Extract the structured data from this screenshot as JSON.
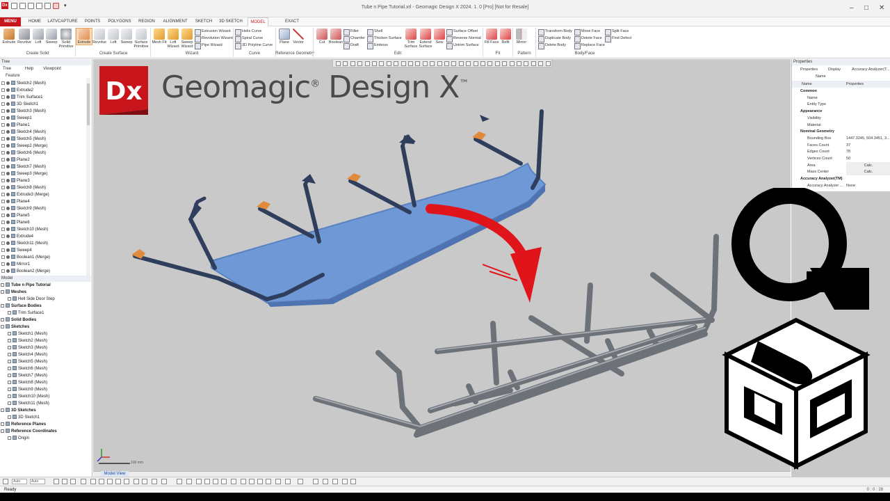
{
  "window": {
    "app_icon": "Dx",
    "title": "Tube n Pipe Tutorial.xrl - Geomagic Design X 2024. 1. 0 [Pro] [Not for Resale]"
  },
  "tabs": [
    "MENU",
    "HOME",
    "LATVCAPTURE",
    "POINTS",
    "POLYGONS",
    "REGION",
    "ALIGNMENT",
    "SKETCH",
    "3D SKETCH",
    "MODEL",
    "EXACT SURFACING"
  ],
  "active_tab": "MODEL",
  "ribbon": {
    "create_solid": {
      "label": "Create Solid",
      "buttons": [
        "Extrude",
        "Revolve",
        "Loft",
        "Sweep",
        "Solid Primitive"
      ]
    },
    "create_surface": {
      "label": "Create Surface",
      "buttons": [
        "Extrude",
        "Revolve",
        "Loft",
        "Sweep",
        "Surface Primitive"
      ]
    },
    "wizard": {
      "label": "Wizard",
      "buttons": [
        "Mesh Fit",
        "Loft Wizard",
        "Sweep Wizard"
      ],
      "small": [
        "Extrusion Wizard",
        "Revolution Wizard",
        "Pipe Wizard"
      ]
    },
    "curve": {
      "label": "Curve",
      "small": [
        "Helix Curve",
        "Spiral Curve",
        "3D Polyline Curve"
      ]
    },
    "reference_geometry": {
      "label": "Reference Geometry",
      "buttons": [
        "Plane",
        "Vector"
      ]
    },
    "edit": {
      "label": "Edit",
      "buttons": [
        "Cut",
        "Boolean"
      ],
      "small": [
        "Fillet",
        "Chamfer",
        "Draft",
        "Shell",
        "Thicken Surface",
        "Emboss"
      ]
    },
    "edit2": {
      "buttons": [
        "Trim Surface",
        "Extend Surface",
        "Sew"
      ],
      "small": [
        "Surface Offset",
        "Reverse Normal",
        "Untrim Surface"
      ]
    },
    "fit": {
      "label": "Fit",
      "buttons": [
        "Fill Face",
        "Refit"
      ]
    },
    "pattern": {
      "label": "Pattern",
      "buttons": [
        "Mirror"
      ]
    },
    "body_face": {
      "label": "Body/Face",
      "small": [
        "Transform Body",
        "Duplicate Body",
        "Delete Body",
        "Move Face",
        "Delete Face",
        "Replace Face",
        "Split Face",
        "Find Defect"
      ]
    }
  },
  "left_panel": {
    "header": "Tree",
    "tabs": [
      "Tree",
      "Help",
      "Viewpoint"
    ],
    "feature_label": "Feature",
    "features": [
      "Sketch2 (Mesh)",
      "Extrude2",
      "Trim Surface1",
      "3D Sketch1",
      "Sketch3 (Mesh)",
      "Sweep1",
      "Plane1",
      "Sketch4 (Mesh)",
      "Sketch5 (Mesh)",
      "Sweep2 (Merge)",
      "Sketch6 (Mesh)",
      "Plane2",
      "Sketch7 (Mesh)",
      "Sweep3 (Merge)",
      "Plane3",
      "Sketch8 (Mesh)",
      "Extrude3 (Merge)",
      "Plane4",
      "Sketch9 (Mesh)",
      "Plane5",
      "Plane6",
      "Sketch10 (Mesh)",
      "Extrude4",
      "Sketch11 (Mesh)",
      "Sweep4",
      "Boolean1 (Merge)",
      "Mirror1",
      "Boolean2 (Merge)"
    ],
    "model_label": "Model",
    "model_tree": [
      {
        "text": "Tube n Pipe Tutorial",
        "bold": true
      },
      {
        "text": "Meshes",
        "bold": true
      },
      {
        "text": "Hell Side Door Step",
        "bold": false
      },
      {
        "text": "Surface Bodies",
        "bold": true
      },
      {
        "text": "Trim Surface1",
        "bold": false
      },
      {
        "text": "Solid Bodies",
        "bold": true
      },
      {
        "text": "Sketches",
        "bold": true
      },
      {
        "text": "Sketch1 (Mesh)",
        "bold": false
      },
      {
        "text": "Sketch2 (Mesh)",
        "bold": false
      },
      {
        "text": "Sketch3 (Mesh)",
        "bold": false
      },
      {
        "text": "Sketch4 (Mesh)",
        "bold": false
      },
      {
        "text": "Sketch5 (Mesh)",
        "bold": false
      },
      {
        "text": "Sketch6 (Mesh)",
        "bold": false
      },
      {
        "text": "Sketch7 (Mesh)",
        "bold": false
      },
      {
        "text": "Sketch8 (Mesh)",
        "bold": false
      },
      {
        "text": "Sketch9 (Mesh)",
        "bold": false
      },
      {
        "text": "Sketch10 (Mesh)",
        "bold": false
      },
      {
        "text": "Sketch11 (Mesh)",
        "bold": false
      },
      {
        "text": "3D Sketches",
        "bold": true
      },
      {
        "text": "3D Sketch1",
        "bold": false
      },
      {
        "text": "Reference Planes",
        "bold": true
      },
      {
        "text": "Reference Coordinates",
        "bold": true
      },
      {
        "text": "Origin",
        "bold": false
      }
    ]
  },
  "viewport": {
    "brand_title": "Geomagic",
    "brand_reg": "®",
    "brand_suffix": "Design X",
    "brand_tm": "™",
    "logo_letters": "Dx",
    "scale_label": "100 mm",
    "view_tab": "Model View"
  },
  "properties": {
    "header": "Properties",
    "tabs": [
      "Properties",
      "Display",
      "Accuracy Analyzer(T..."
    ],
    "name_label": "Name",
    "col_name": "Name",
    "col_props": "Properties",
    "rows": [
      {
        "k": "Common",
        "v": "",
        "cat": true
      },
      {
        "k": "Name",
        "v": "",
        "cat": false
      },
      {
        "k": "Entity Type",
        "v": "",
        "cat": false
      },
      {
        "k": "Appearance",
        "v": "",
        "cat": true
      },
      {
        "k": "Visibility",
        "v": "",
        "cat": false
      },
      {
        "k": "Material",
        "v": "",
        "cat": false
      },
      {
        "k": "Nominal Geometry",
        "v": "",
        "cat": true
      },
      {
        "k": "Bounding Box",
        "v": "1447.3245, 504.3451, 3...",
        "cat": false
      },
      {
        "k": "Faces Count",
        "v": "37",
        "cat": false
      },
      {
        "k": "Edges Count",
        "v": "78",
        "cat": false
      },
      {
        "k": "Vertices Count",
        "v": "50",
        "cat": false
      },
      {
        "k": "Area",
        "v": "Calc.",
        "cat": false
      },
      {
        "k": "Mass Center",
        "v": "Calc.",
        "cat": false
      },
      {
        "k": "Accuracy Analyzer(TM)",
        "v": "",
        "cat": true
      },
      {
        "k": "Accuracy Analyzer ...",
        "v": "None",
        "cat": false
      }
    ],
    "material_color": "#e7e27a"
  },
  "bottom": {
    "select1": "Auto",
    "select2": "Auto"
  },
  "status": {
    "text": "Ready",
    "right": "0 : 0 : 28"
  },
  "colors": {
    "accent": "#c4161c",
    "mesh_blue": "#6f98d6",
    "tube_dark": "#2f3e5c",
    "tube_gray": "#7b8087",
    "arrow_red": "#e0141b"
  }
}
